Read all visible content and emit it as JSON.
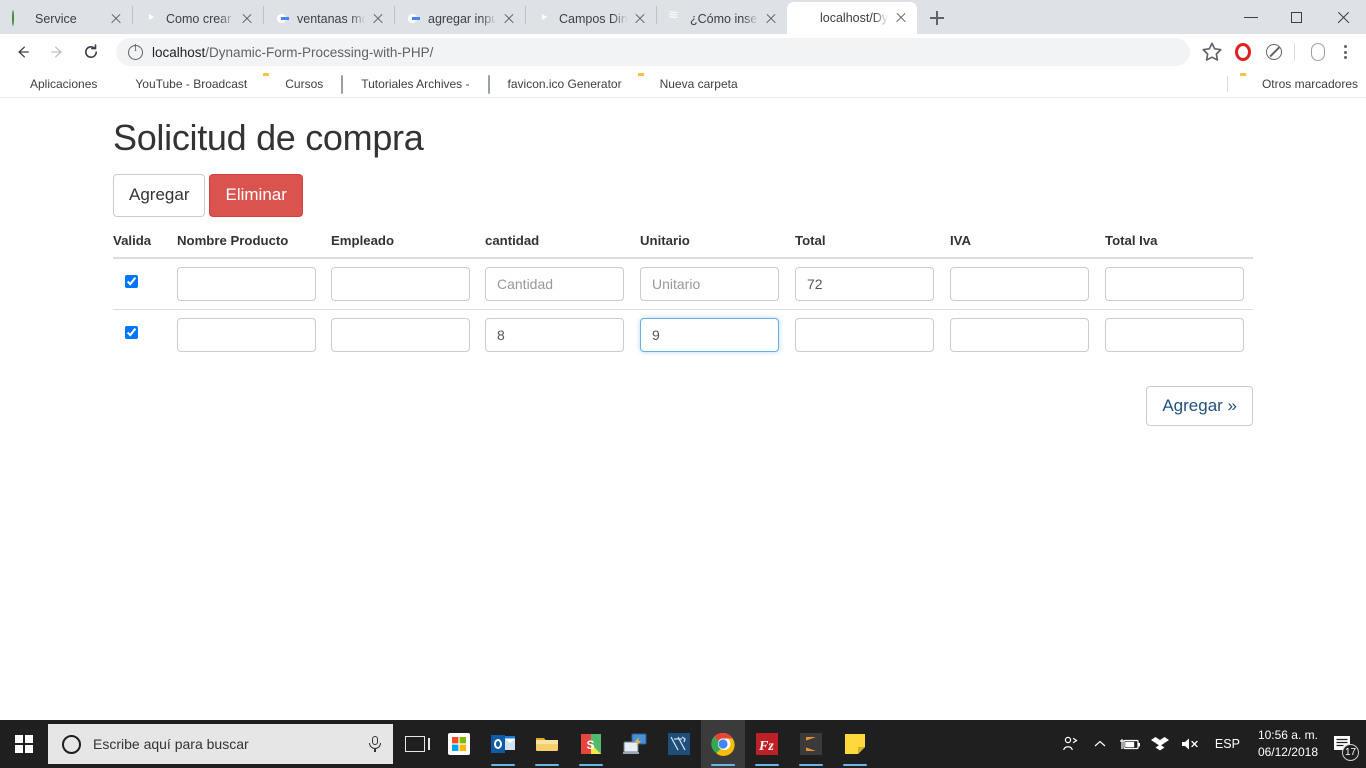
{
  "browser": {
    "tabs": [
      {
        "title": "Service",
        "favicon": "green-sphere-icon",
        "active": false
      },
      {
        "title": "Como crear ventan",
        "favicon": "youtube-icon",
        "active": false
      },
      {
        "title": "ventanas modales",
        "favicon": "google-icon",
        "active": false
      },
      {
        "title": "agregar input dina",
        "favicon": "google-icon",
        "active": false
      },
      {
        "title": "Campos Dinámicos",
        "favicon": "youtube-icon",
        "active": false
      },
      {
        "title": "¿Cómo insertar arr",
        "favicon": "slideshare-icon",
        "active": false
      },
      {
        "title": "localhost/Dynamic",
        "favicon": "wamp-icon",
        "active": true
      }
    ],
    "new_tab_label": "+",
    "window_controls": {
      "minimize": "minimize-icon",
      "maximize": "maximize-icon",
      "close": "close-icon"
    },
    "omnibox": {
      "url_host": "localhost",
      "url_path": "/Dynamic-Form-Processing-with-PHP/",
      "security_icon": "info-circle-icon",
      "star_icon": "bookmark-star-icon"
    },
    "toolbar_icons": [
      "opera-icon",
      "adblock-icon",
      "profile-icon",
      "menu-dots-icon"
    ],
    "bookmarks": [
      {
        "label": "Aplicaciones",
        "icon": "apps-grid-icon"
      },
      {
        "label": "YouTube - Broadcast",
        "icon": "youtube-icon"
      },
      {
        "label": "Cursos",
        "icon": "folder-icon"
      },
      {
        "label": "Tutoriales Archives -",
        "icon": "document-icon"
      },
      {
        "label": "favicon.ico Generator",
        "icon": "document-icon"
      },
      {
        "label": "Nueva carpeta",
        "icon": "folder-icon"
      }
    ],
    "other_bookmarks": {
      "label": "Otros marcadores",
      "icon": "folder-icon"
    }
  },
  "page": {
    "title": "Solicitud de compra",
    "buttons": {
      "add_label": "Agregar",
      "delete_label": "Eliminar",
      "next_label": "Agregar »"
    },
    "colors": {
      "danger": "#d9534f",
      "focus_border": "#66afe9",
      "link": "#23527c",
      "text": "#333333"
    },
    "table": {
      "headers": [
        "Valida",
        "Nombre Producto",
        "Empleado",
        "cantidad",
        "Unitario",
        "Total",
        "IVA",
        "Total Iva"
      ],
      "rows": [
        {
          "valida_checked": true,
          "nombre": {
            "value": "",
            "placeholder": ""
          },
          "empleado": {
            "value": "",
            "placeholder": ""
          },
          "cantidad": {
            "value": "",
            "placeholder": "Cantidad"
          },
          "unitario": {
            "value": "",
            "placeholder": "Unitario"
          },
          "total": {
            "value": "72",
            "placeholder": ""
          },
          "iva": {
            "value": "",
            "placeholder": ""
          },
          "total_iva": {
            "value": "",
            "placeholder": ""
          },
          "focused_field": ""
        },
        {
          "valida_checked": true,
          "nombre": {
            "value": "",
            "placeholder": ""
          },
          "empleado": {
            "value": "",
            "placeholder": ""
          },
          "cantidad": {
            "value": "8",
            "placeholder": ""
          },
          "unitario": {
            "value": "9",
            "placeholder": ""
          },
          "total": {
            "value": "",
            "placeholder": ""
          },
          "iva": {
            "value": "",
            "placeholder": ""
          },
          "total_iva": {
            "value": "",
            "placeholder": ""
          },
          "focused_field": "unitario"
        }
      ]
    }
  },
  "taskbar": {
    "start_icon": "windows-logo-icon",
    "search_placeholder": "Escribe aquí para buscar",
    "mic_icon": "microphone-icon",
    "taskview_icon": "task-view-icon",
    "apps": [
      {
        "name": "microsoft-store-icon",
        "running": false,
        "active": false
      },
      {
        "name": "outlook-icon",
        "running": true,
        "active": false
      },
      {
        "name": "file-explorer-icon",
        "running": true,
        "active": false
      },
      {
        "name": "snagit-icon",
        "running": true,
        "active": false
      },
      {
        "name": "remote-desktop-icon",
        "running": false,
        "active": false
      },
      {
        "name": "visio-icon",
        "running": false,
        "active": false
      },
      {
        "name": "google-chrome-icon",
        "running": true,
        "active": true
      },
      {
        "name": "filezilla-icon",
        "running": true,
        "active": false
      },
      {
        "name": "sublime-text-icon",
        "running": true,
        "active": false
      },
      {
        "name": "sticky-notes-icon",
        "running": true,
        "active": false
      }
    ],
    "tray": {
      "people_icon": "people-icon",
      "chevron_icon": "chevron-up-icon",
      "battery_icon": "battery-charging-icon",
      "dropbox_icon": "dropbox-icon",
      "volume_icon": "volume-muted-icon",
      "language": "ESP",
      "time": "10:56 a. m.",
      "date": "06/12/2018",
      "action_center_icon": "action-center-icon",
      "notification_count": "17"
    }
  }
}
